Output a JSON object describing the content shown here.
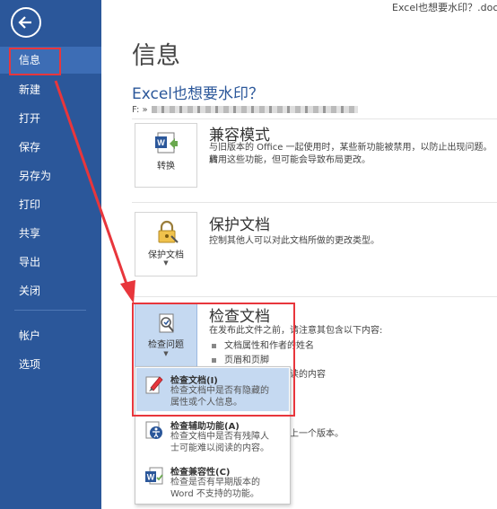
{
  "window": {
    "title": "Excel也想要水印？.docx ["
  },
  "sidebar": {
    "items": [
      {
        "label": "信息"
      },
      {
        "label": "新建"
      },
      {
        "label": "打开"
      },
      {
        "label": "保存"
      },
      {
        "label": "另存为"
      },
      {
        "label": "打印"
      },
      {
        "label": "共享"
      },
      {
        "label": "导出"
      },
      {
        "label": "关闭"
      },
      {
        "label": "帐户"
      },
      {
        "label": "选项"
      }
    ]
  },
  "main": {
    "title": "信息",
    "doc_name": "Excel也想要水印？",
    "path_prefix": "F: »",
    "sections": [
      {
        "button": "转换",
        "title": "兼容模式",
        "desc1": "与旧版本的 Office 一起使用时，某些新功能被禁用，以防止出现问题。转",
        "desc2": "启用这些功能，但可能会导致布局更改。"
      },
      {
        "button": "保护文档",
        "title": "保护文档",
        "desc1": "控制其他人可以对此文档所做的更改类型。"
      },
      {
        "button": "检查问题",
        "title": "检查文档",
        "desc1": "在发布此文件之前，请注意其包含以下内容:",
        "bullets": [
          "文档属性和作者的姓名",
          "页眉和页脚"
        ],
        "partial1": "读的内容",
        "partial2": "上一个版本。"
      }
    ]
  },
  "menu": {
    "items": [
      {
        "title": "检查文档(I)",
        "line1": "检查文档中是否有隐藏的",
        "line2": "属性或个人信息。"
      },
      {
        "title": "检查辅助功能(A)",
        "line1": "检查文档中是否有残障人",
        "line2": "士可能难以阅读的内容。"
      },
      {
        "title": "检查兼容性(C)",
        "line1": "检查是否有早期版本的",
        "line2": "Word 不支持的功能。"
      }
    ]
  },
  "colors": {
    "sidebar": "#2b579a",
    "highlight": "#c5d9f1",
    "annotation": "#e8363c"
  }
}
